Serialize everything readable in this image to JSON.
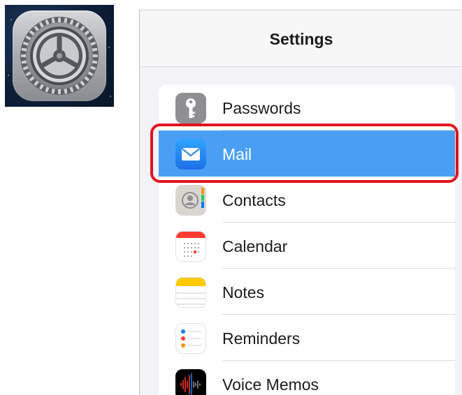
{
  "app_icon": {
    "name": "Settings",
    "icon": "gear-icon"
  },
  "header": {
    "title": "Settings"
  },
  "rows": [
    {
      "label": "Passwords",
      "icon": "key-icon",
      "color": "#8e8e93"
    },
    {
      "label": "Mail",
      "icon": "envelope-icon",
      "color": "#1e90ff",
      "selected": true
    },
    {
      "label": "Contacts",
      "icon": "contacts-icon",
      "color": "#c7c7cc"
    },
    {
      "label": "Calendar",
      "icon": "calendar-icon",
      "color": "#ff3b30"
    },
    {
      "label": "Notes",
      "icon": "notes-icon",
      "color": "#ffcc00"
    },
    {
      "label": "Reminders",
      "icon": "reminders-icon",
      "color": "#ffffff"
    },
    {
      "label": "Voice Memos",
      "icon": "waveform-icon",
      "color": "#000000"
    }
  ],
  "highlight_color": "#e0141e"
}
